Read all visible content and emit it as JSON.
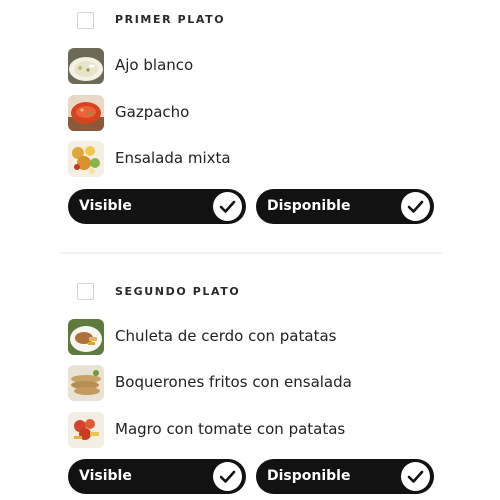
{
  "sections": [
    {
      "title": "PRIMER PLATO",
      "dishes": [
        {
          "name": "Ajo blanco",
          "image": "ajo-blanco-thumbnail"
        },
        {
          "name": "Gazpacho",
          "image": "gazpacho-thumbnail"
        },
        {
          "name": "Ensalada mixta",
          "image": "ensalada-mixta-thumbnail"
        }
      ],
      "visible_label": "Visible",
      "available_label": "Disponible",
      "visible_checked": true,
      "available_checked": true
    },
    {
      "title": "SEGUNDO PLATO",
      "dishes": [
        {
          "name": "Chuleta de cerdo con patatas",
          "image": "chuleta-thumbnail"
        },
        {
          "name": "Boquerones fritos con ensalada",
          "image": "boquerones-thumbnail"
        },
        {
          "name": "Magro con tomate con patatas",
          "image": "magro-thumbnail"
        }
      ],
      "visible_label": "Visible",
      "available_label": "Disponible",
      "visible_checked": true,
      "available_checked": true
    }
  ],
  "colors": {
    "pill_background": "#121212",
    "check_color": "#121212",
    "checkbox_border": "#d4d4d4"
  },
  "icons": {
    "toggle_check": "check-circle-icon",
    "section_checkbox": "checkbox-icon"
  }
}
